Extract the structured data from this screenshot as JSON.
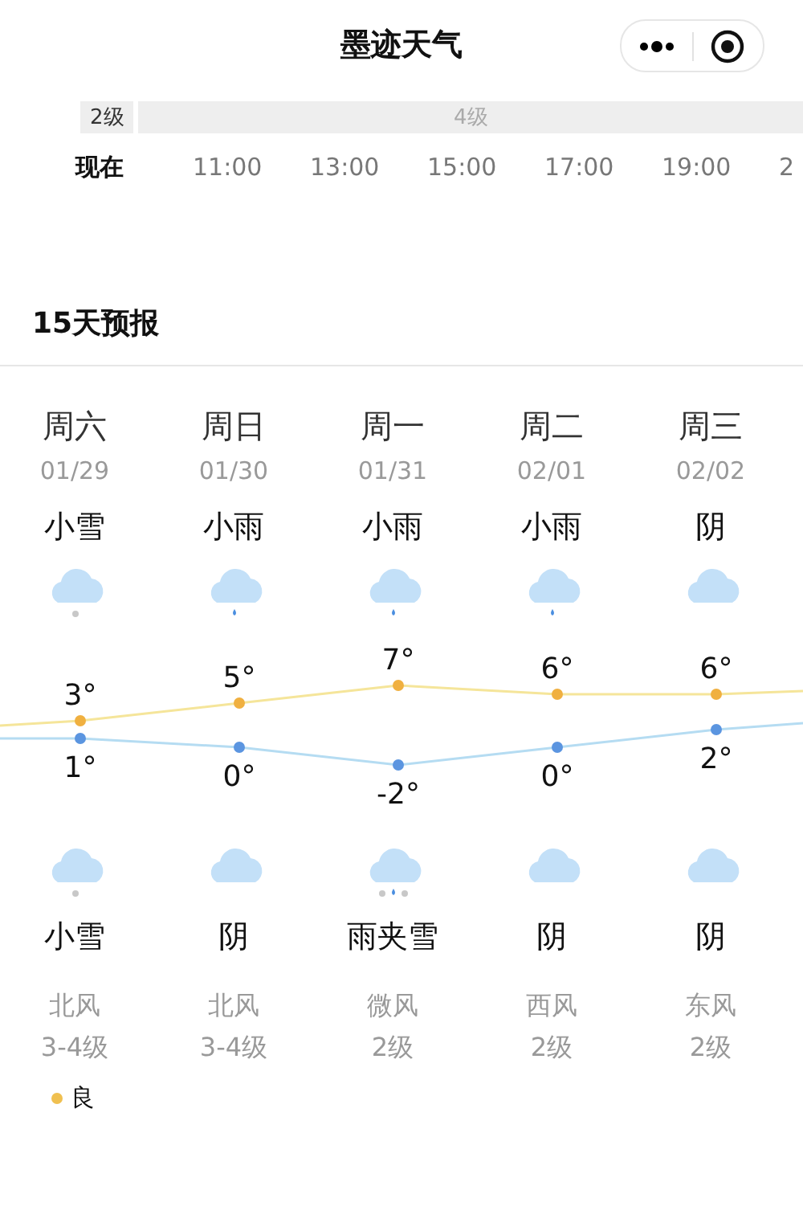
{
  "nav_bar": {
    "title": "墨迹天气"
  },
  "hourly": {
    "wind_levels": [
      "2级",
      "4级"
    ],
    "times": [
      {
        "label": "现在",
        "selected": true
      },
      {
        "label": "11:00",
        "selected": false
      },
      {
        "label": "13:00",
        "selected": false
      },
      {
        "label": "15:00",
        "selected": false
      },
      {
        "label": "17:00",
        "selected": false
      },
      {
        "label": "19:00",
        "selected": false
      },
      {
        "label": "2",
        "selected": false
      }
    ]
  },
  "forecast": {
    "title": "15天预报",
    "days": [
      {
        "weekday": "周六",
        "date": "01/29",
        "day_weather": "小雪",
        "day_icon": {
          "kind": "snow"
        },
        "night_icon": {
          "kind": "snow"
        },
        "night_weather": "小雪",
        "wind_direction": "北风",
        "wind_level": "3-4级"
      },
      {
        "weekday": "周日",
        "date": "01/30",
        "day_weather": "小雨",
        "day_icon": {
          "kind": "rain"
        },
        "night_icon": {
          "kind": "cloud"
        },
        "night_weather": "阴",
        "wind_direction": "北风",
        "wind_level": "3-4级"
      },
      {
        "weekday": "周一",
        "date": "01/31",
        "day_weather": "小雨",
        "day_icon": {
          "kind": "rain"
        },
        "night_icon": {
          "kind": "sleet"
        },
        "night_weather": "雨夹雪",
        "wind_direction": "微风",
        "wind_level": "2级"
      },
      {
        "weekday": "周二",
        "date": "02/01",
        "day_weather": "小雨",
        "day_icon": {
          "kind": "rain"
        },
        "night_icon": {
          "kind": "cloud"
        },
        "night_weather": "阴",
        "wind_direction": "西风",
        "wind_level": "2级"
      },
      {
        "weekday": "周三",
        "date": "02/02",
        "day_weather": "阴",
        "day_icon": {
          "kind": "cloud"
        },
        "night_icon": {
          "kind": "cloud"
        },
        "night_weather": "阴",
        "wind_direction": "东风",
        "wind_level": "2级"
      }
    ],
    "chart_data": {
      "type": "line",
      "categories": [
        null,
        null,
        null,
        null,
        null
      ],
      "series": [
        {
          "color": "#f5e59a",
          "marker": {
            "shape": "circle",
            "color": "#f0b040"
          },
          "values": [
            3,
            5,
            7,
            6,
            6
          ],
          "value_labels": [
            "3°",
            "5°",
            "7°",
            "6°",
            "6°"
          ]
        },
        {
          "color": "#b5dcf2",
          "marker": {
            "shape": "circle",
            "color": "#5b95e0"
          },
          "values": [
            1,
            0,
            -2,
            0,
            2
          ],
          "value_labels": [
            "1°",
            "0°",
            "-2°",
            "0°",
            "2°"
          ]
        }
      ]
    },
    "air_quality": {
      "label": "良",
      "color": "#f0c050"
    }
  }
}
